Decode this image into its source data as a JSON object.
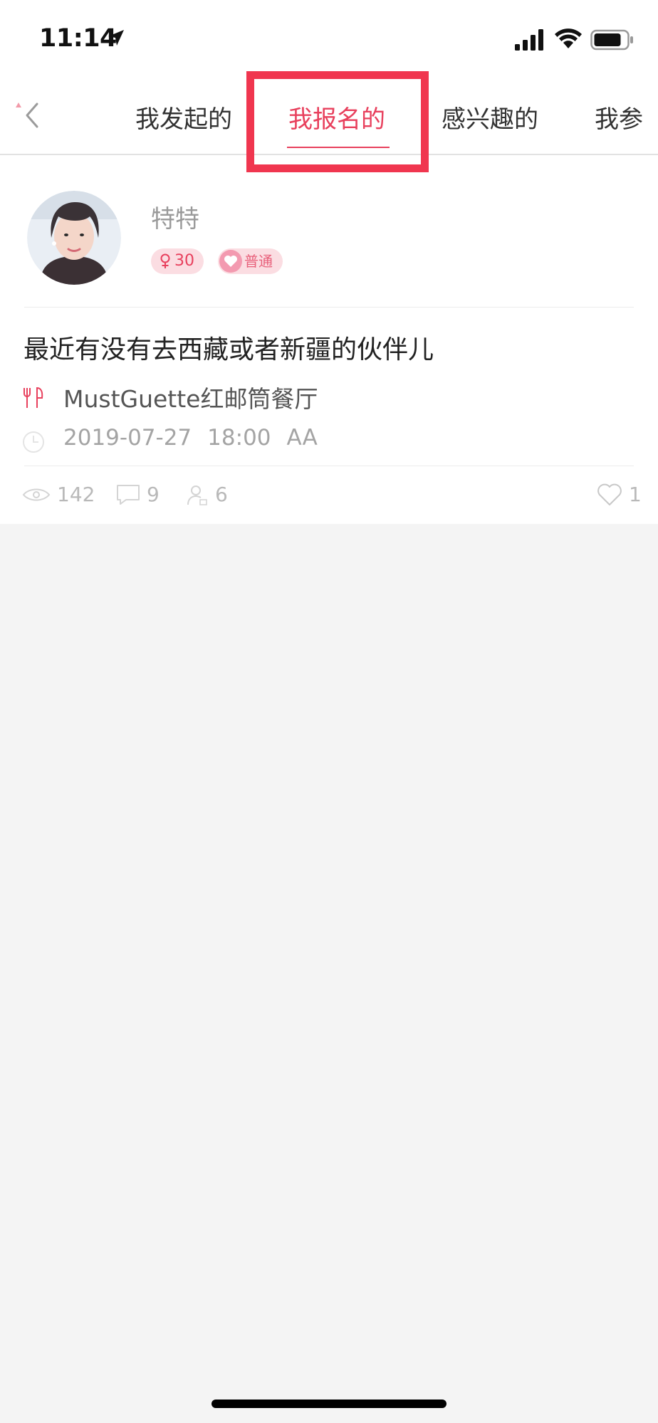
{
  "status_bar": {
    "time": "11:14"
  },
  "nav": {
    "tabs": [
      {
        "label": "我发起的",
        "active": false
      },
      {
        "label": "我报名的",
        "active": true
      },
      {
        "label": "感兴趣的",
        "active": false
      },
      {
        "label": "我参",
        "active": false
      }
    ],
    "active_color": "#e8405d",
    "highlight_color": "#f0364f"
  },
  "card": {
    "username": "特特",
    "age": "30",
    "gender_icon": "female-icon",
    "level": "普通",
    "title": "最近有没有去西藏或者新疆的伙伴儿",
    "place": "MustGuette红邮筒餐厅",
    "date": "2019-07-27",
    "time": "18:00",
    "pay_type": "AA",
    "views": "142",
    "comments": "9",
    "participants": "6",
    "likes": "1"
  }
}
